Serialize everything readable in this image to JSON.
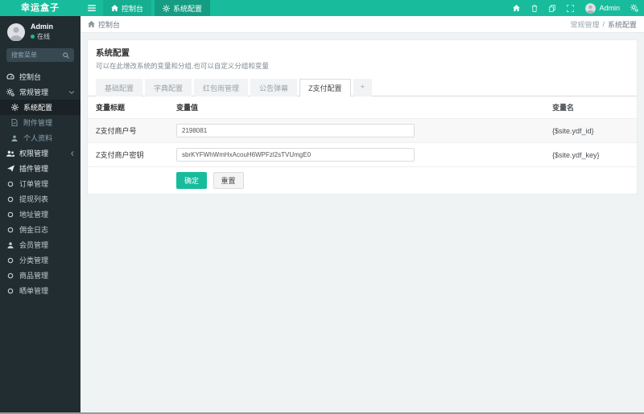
{
  "app": {
    "logo": "幸运盒子"
  },
  "colors": {
    "accent": "#18BC9C",
    "sidebar_bg": "#222D32",
    "content_bg": "#F0F3F4",
    "active_submenu_bg": "#1A2226"
  },
  "sidebar": {
    "user": {
      "name": "Admin",
      "status": "在线"
    },
    "search_placeholder": "搜索菜单",
    "items": [
      {
        "label": "控制台"
      },
      {
        "label": "常规管理"
      },
      {
        "label": "系统配置"
      },
      {
        "label": "附件管理"
      },
      {
        "label": "个人资料"
      },
      {
        "label": "权限管理"
      },
      {
        "label": "插件管理"
      },
      {
        "label": "订单管理"
      },
      {
        "label": "提现列表"
      },
      {
        "label": "地址管理"
      },
      {
        "label": "佣金日志"
      },
      {
        "label": "会员管理"
      },
      {
        "label": "分类管理"
      },
      {
        "label": "商品管理"
      },
      {
        "label": "晒单管理"
      }
    ]
  },
  "topbar": {
    "tabs": [
      {
        "label": "控制台"
      },
      {
        "label": "系统配置"
      }
    ],
    "user": "Admin"
  },
  "content_header": {
    "title": "控制台",
    "breadcrumb": {
      "parent": "常规管理",
      "separator": "/",
      "current": "系统配置"
    }
  },
  "panel": {
    "title": "系统配置",
    "subtitle": "可以在此增改系统的变量和分组,也可以自定义分组和变量",
    "tabs": [
      "基础配置",
      "字典配置",
      "红包雨管理",
      "公告弹幕",
      "Z支付配置",
      "+"
    ],
    "active_tab": "Z支付配置",
    "table": {
      "headers": [
        "变量标题",
        "变量值",
        "变量名"
      ],
      "rows": [
        {
          "title": "Z支付商户号",
          "value": "2198081",
          "name": "{$site.ydf_id}"
        },
        {
          "title": "Z支付商户密钥",
          "value": "sbrKYFWhWmHxAcouH6WPFzl2sTVUmgE0",
          "name": "{$site.ydf_key}"
        }
      ]
    },
    "submit_label": "确定",
    "reset_label": "重置"
  }
}
